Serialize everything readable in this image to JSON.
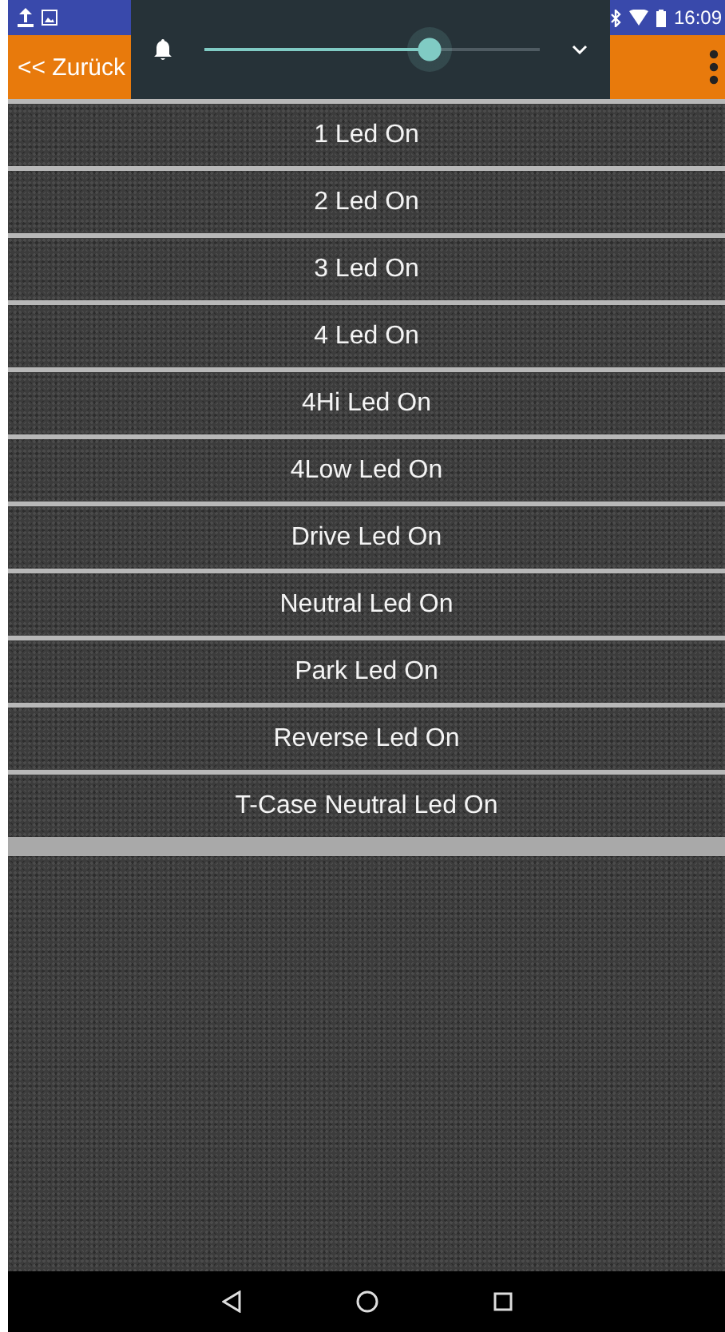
{
  "status_bar": {
    "time": "16:09"
  },
  "action_bar": {
    "back_label": "<< Zurück"
  },
  "volume_panel": {
    "level": 0.67
  },
  "buttons": [
    "1 Led On",
    "2 Led On",
    "3 Led On",
    "4 Led On",
    "4Hi Led On",
    "4Low Led On",
    "Drive Led On",
    "Neutral Led On",
    "Park Led On",
    "Reverse Led On",
    "T-Case Neutral Led On"
  ]
}
